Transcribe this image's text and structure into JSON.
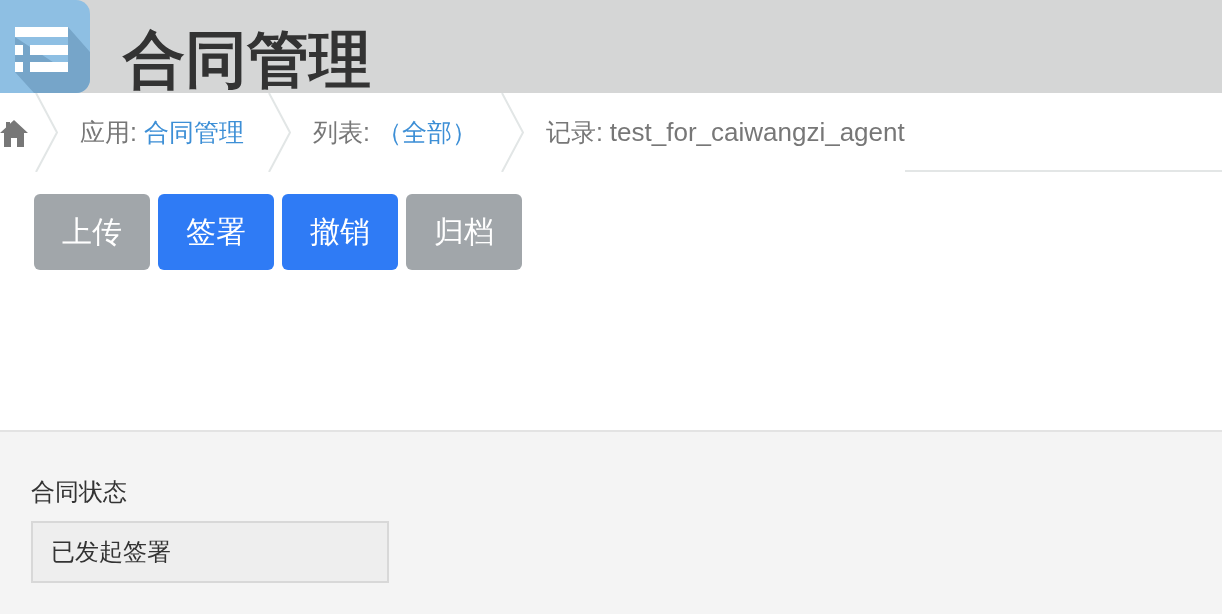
{
  "header": {
    "title": "合同管理"
  },
  "breadcrumb": [
    {
      "kind": "link",
      "label": "应用:",
      "value": "合同管理"
    },
    {
      "kind": "link",
      "label": "列表:",
      "value": "（全部）"
    },
    {
      "kind": "text",
      "label": "记录:",
      "value": "test_for_caiwangzi_agent"
    }
  ],
  "actions": [
    {
      "label": "上传",
      "disabled": true
    },
    {
      "label": "签署",
      "disabled": false
    },
    {
      "label": "撤销",
      "disabled": false
    },
    {
      "label": "归档",
      "disabled": true
    }
  ],
  "form": {
    "fields": [
      {
        "label": "合同状态",
        "value": "已发起签署"
      }
    ]
  }
}
